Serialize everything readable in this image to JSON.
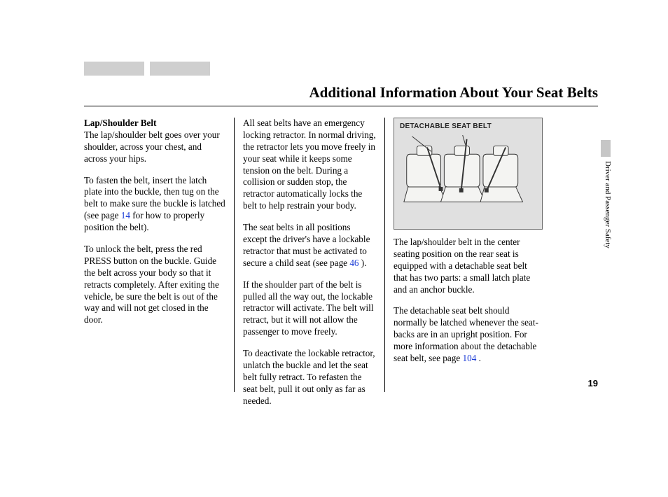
{
  "title": "Additional Information About Your Seat Belts",
  "side_section": "Driver and Passenger Safety",
  "page_number": "19",
  "col1": {
    "heading": "Lap/Shoulder Belt",
    "p1": "The lap/shoulder belt goes over your shoulder, across your chest, and across your hips.",
    "p2a": "To fasten the belt, insert the latch plate into the buckle, then tug on the belt to make sure the buckle is latched (see page ",
    "p2_ref": "14",
    "p2b": " for how to properly position the belt).",
    "p3": "To unlock the belt, press the red PRESS button on the buckle. Guide the belt across your body so that it retracts completely. After exiting the vehicle, be sure the belt is out of the way and will not get closed in the door."
  },
  "col2": {
    "p1": "All seat belts have an emergency locking retractor. In normal driving, the retractor lets you move freely in your seat while it keeps some tension on the belt. During a collision or sudden stop, the retractor automatically locks the belt to help restrain your body.",
    "p2a": "The seat belts in all positions except the driver's have a lockable retractor that must be activated to secure a child seat (see page ",
    "p2_ref": "46",
    "p2b": " ).",
    "p3": "If the shoulder part of the belt is pulled all the way out, the lockable retractor will activate. The belt will retract, but it will not allow the passenger to move freely.",
    "p4": "To deactivate the lockable retractor, unlatch the buckle and let the seat belt fully retract. To refasten the seat belt, pull it out only as far as needed."
  },
  "col3": {
    "fig_label": "DETACHABLE SEAT BELT",
    "p1": "The lap/shoulder belt in the center seating position on the rear seat is equipped with a detachable seat belt that has two parts: a small latch plate and an anchor buckle.",
    "p2a": "The detachable seat belt should normally be latched whenever the seat-backs are in an upright position. For more information about the detachable seat belt, see page ",
    "p2_ref": "104",
    "p2b": " ."
  }
}
